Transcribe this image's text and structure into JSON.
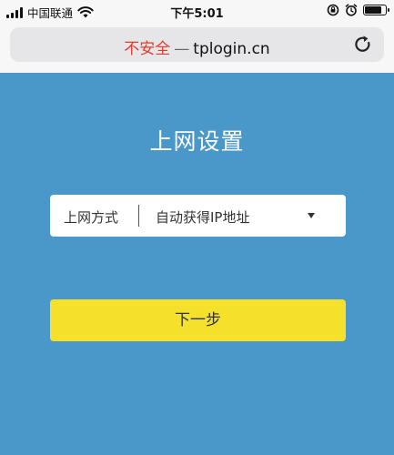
{
  "status_bar": {
    "carrier": "中国联通",
    "time": "下午5:01",
    "battery_level": 0.85,
    "icons": [
      "signal-icon",
      "wifi-icon",
      "rotation-lock-icon",
      "alarm-icon",
      "battery-icon"
    ]
  },
  "browser": {
    "insecure_label": "不安全",
    "separator": "—",
    "domain": "tplogin.cn",
    "reload_icon": "reload-icon"
  },
  "page": {
    "title": "上网设置",
    "connection_type": {
      "label": "上网方式",
      "value": "自动获得IP地址"
    },
    "next_button": "下一步"
  },
  "colors": {
    "background": "#4a97c9",
    "insecure": "#e23b2e",
    "button": "#f5e12c"
  }
}
